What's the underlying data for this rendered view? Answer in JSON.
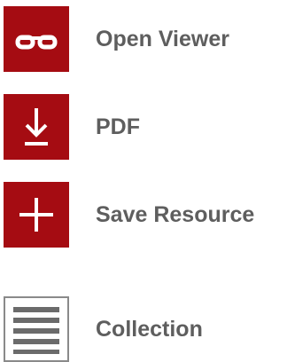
{
  "colors": {
    "accent": "#a50c12",
    "label_text": "#5e5e5e",
    "outline_gray": "#8a8a8a",
    "background": "#ffffff"
  },
  "actions": [
    {
      "label": "Open Viewer",
      "icon": "glasses-icon"
    },
    {
      "label": "PDF",
      "icon": "download-icon"
    },
    {
      "label": "Save Resource",
      "icon": "plus-icon"
    },
    {
      "label": "Collection",
      "icon": "list-lines-icon"
    }
  ]
}
